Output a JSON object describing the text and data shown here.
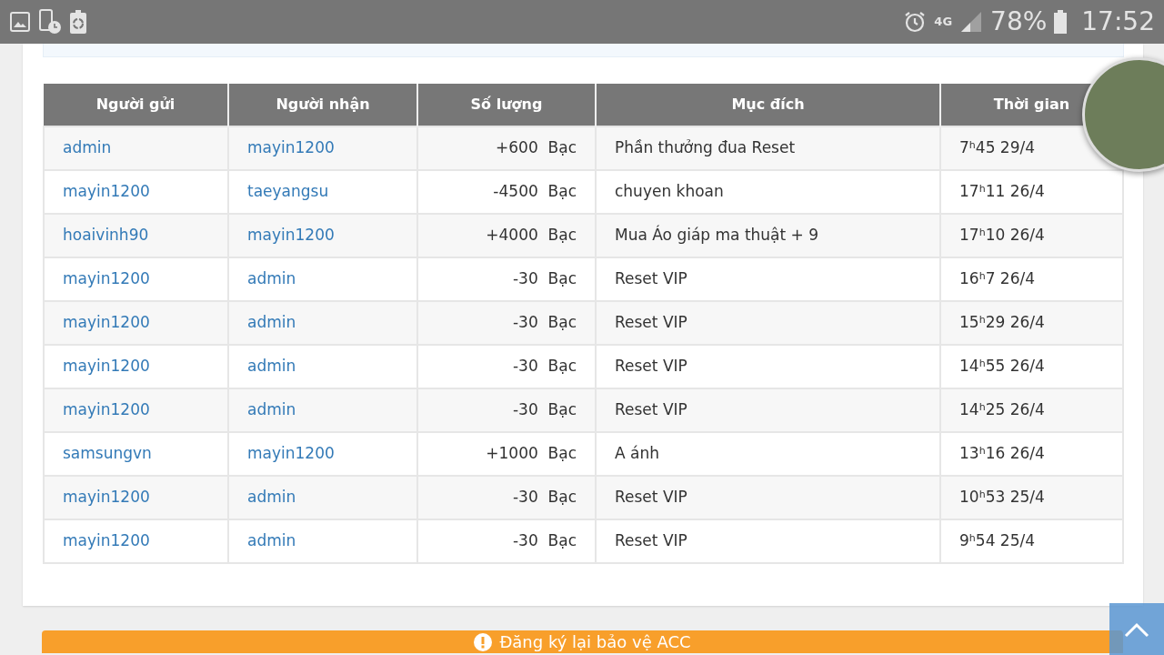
{
  "status_bar": {
    "network": "4G",
    "battery": "78%",
    "time": "17:52"
  },
  "table": {
    "columns": [
      "Người gửi",
      "Người nhận",
      "Số lượng",
      "Mục đích",
      "Thời gian"
    ],
    "rows": [
      {
        "sender": "admin",
        "receiver": "mayin1200",
        "amount": "+600",
        "currency": "Bạc",
        "purpose": "Phần thưởng đua Reset",
        "time": "7$^{h}$45 29/4"
      },
      {
        "sender": "mayin1200",
        "receiver": "taeyangsu",
        "amount": "-4500",
        "currency": "Bạc",
        "purpose": "chuyen khoan",
        "time": "17$^{h}$11 26/4"
      },
      {
        "sender": "hoaivinh90",
        "receiver": "mayin1200",
        "amount": "+4000",
        "currency": "Bạc",
        "purpose": "Mua Áo giáp ma thuật + 9",
        "time": "17$^{h}$10 26/4"
      },
      {
        "sender": "mayin1200",
        "receiver": "admin",
        "amount": "-30",
        "currency": "Bạc",
        "purpose": "Reset VIP",
        "time": "16$^{h}$7 26/4"
      },
      {
        "sender": "mayin1200",
        "receiver": "admin",
        "amount": "-30",
        "currency": "Bạc",
        "purpose": "Reset VIP",
        "time": "15$^{h}$29 26/4"
      },
      {
        "sender": "mayin1200",
        "receiver": "admin",
        "amount": "-30",
        "currency": "Bạc",
        "purpose": "Reset VIP",
        "time": "14$^{h}$55 26/4"
      },
      {
        "sender": "mayin1200",
        "receiver": "admin",
        "amount": "-30",
        "currency": "Bạc",
        "purpose": "Reset VIP",
        "time": "14$^{h}$25 26/4"
      },
      {
        "sender": "samsungvn",
        "receiver": "mayin1200",
        "amount": "+1000",
        "currency": "Bạc",
        "purpose": "A ánh",
        "time": "13$^{h}$16 26/4"
      },
      {
        "sender": "mayin1200",
        "receiver": "admin",
        "amount": "-30",
        "currency": "Bạc",
        "purpose": "Reset VIP",
        "time": "10$^{h}$53 25/4"
      },
      {
        "sender": "mayin1200",
        "receiver": "admin",
        "amount": "-30",
        "currency": "Bạc",
        "purpose": "Reset VIP",
        "time": "9$^{h}$54 25/4"
      }
    ]
  },
  "action_button": {
    "label": "Đăng ký lại bảo vệ ACC"
  }
}
